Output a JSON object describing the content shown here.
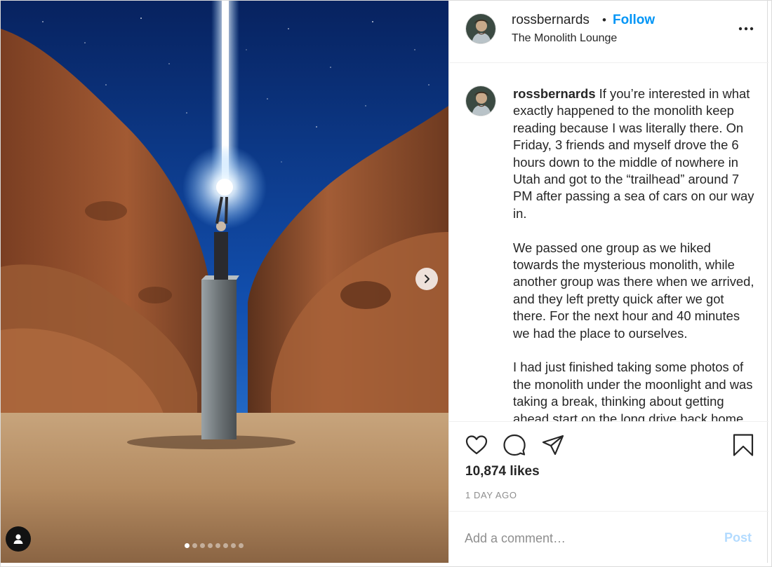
{
  "media": {
    "carousel_count": 8,
    "active_index": 0,
    "next_icon": "chevron-right-icon",
    "user_tag_icon": "person-icon"
  },
  "header": {
    "username": "rossbernards",
    "separator": "•",
    "follow_label": "Follow",
    "location": "The Monolith Lounge",
    "more_icon": "more-horizontal-icon"
  },
  "caption": {
    "username": "rossbernards",
    "paragraphs": [
      "If you’re interested in what exactly happened to the monolith keep reading because I was literally there. On Friday, 3 friends and myself drove the 6 hours down to the middle of nowhere in Utah and got to the “trailhead” around 7 PM after passing a sea of cars on our way in.",
      "We passed one group as we hiked towards the mysterious monolith, while another group was there when we arrived, and they left pretty quick after we got there. For the next hour and 40 minutes we had the place to ourselves.",
      "I had just finished taking some photos of the monolith under the moonlight and was taking a break, thinking about getting ahead start on the long drive back home when we heard voices in the distance."
    ]
  },
  "actions": {
    "like_icon": "heart-icon",
    "comment_icon": "comment-icon",
    "share_icon": "paper-plane-icon",
    "save_icon": "bookmark-icon",
    "likes": "10,874 likes",
    "time_ago": "1 DAY AGO"
  },
  "comment_box": {
    "placeholder": "Add a comment…",
    "post_label": "Post"
  },
  "colors": {
    "accent": "#0095f6",
    "post_disabled": "#b3dbff",
    "muted": "#8e8e8e",
    "text": "#262626"
  }
}
